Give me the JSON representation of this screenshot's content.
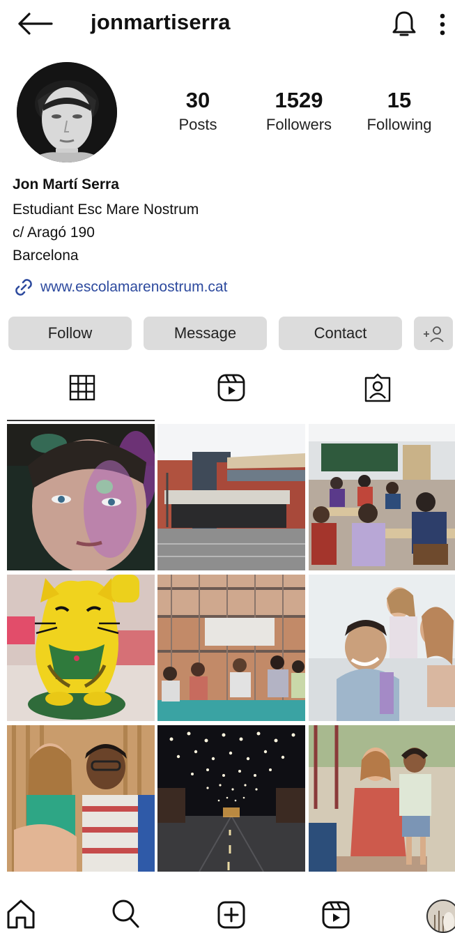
{
  "header": {
    "username": "jonmartiserra"
  },
  "profile": {
    "stats": [
      {
        "value": "30",
        "label": "Posts"
      },
      {
        "value": "1529",
        "label": "Followers"
      },
      {
        "value": "15",
        "label": "Following"
      }
    ],
    "name": "Jon Martí Serra",
    "bio_lines": [
      "Estudiant Esc Mare Nostrum",
      "c/ Aragó 190",
      "Barcelona"
    ],
    "link": "www.escolamarenostrum.cat"
  },
  "actions": {
    "follow": "Follow",
    "message": "Message",
    "contact": "Contact"
  },
  "colors": {
    "link": "#2d4a9e",
    "button_bg": "#dcdcdc",
    "tab_active": "#333333"
  },
  "grid": [
    {
      "name": "post-portrait-boy-colored-light"
    },
    {
      "name": "post-school-building"
    },
    {
      "name": "post-classroom"
    },
    {
      "name": "post-yellow-lucky-cat"
    },
    {
      "name": "post-kids-sitting-by-fence"
    },
    {
      "name": "post-family-piggyback"
    },
    {
      "name": "post-two-kids-smiling"
    },
    {
      "name": "post-street-lights-night"
    },
    {
      "name": "post-kids-playground"
    }
  ],
  "bottom_nav": [
    "home-icon",
    "search-icon",
    "create-icon",
    "reels-icon",
    "profile-avatar"
  ]
}
